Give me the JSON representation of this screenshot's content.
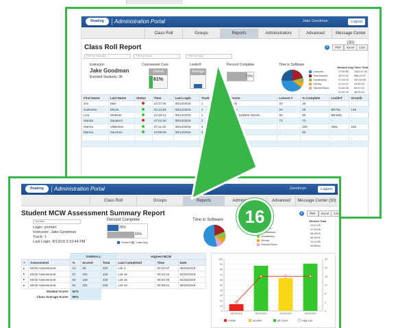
{
  "colors": {
    "accent_green": "#3ab54a",
    "header_blue": "#1e4d8c",
    "red": "#e8231c",
    "green": "#35c52d",
    "yellow": "#f7d716"
  },
  "top_stub": {
    "visible": true
  },
  "back": {
    "app": {
      "logo": "Reading Discovery",
      "title": "Administration Portal",
      "user": "Jake Goodman",
      "logout": "Logout"
    },
    "tabs": [
      "Class Roll",
      "Groups",
      "Reports",
      "Administrators",
      "Advanced",
      "Message Center (30)"
    ],
    "active_tab": "Reports",
    "report_title": "Class Roll Report",
    "buttons": [
      "PDF",
      "Excel",
      "CSV"
    ],
    "filters": [
      "Filter by Instructor",
      "Filter by Group",
      "Filter by Track"
    ],
    "instructor_label": "Instructor:",
    "instructor_name": "Jake Goodman",
    "enrolled": "Enrolled Students: 36",
    "summary_labels": [
      "Coursework Core",
      "Lexile®",
      "Percent Complete",
      "Time in Software"
    ],
    "overall_label": "Overall",
    "overall_value": "61%",
    "average_label": "Average",
    "percent_complete": "73%",
    "time_legend": [
      "Lessons",
      "Test/Assess",
      "Vocabulary",
      "Library",
      "Games/Store"
    ],
    "student_avg_label": "Student Avg",
    "class_total_label": "Class Total",
    "student_avg_values": [
      "27:50:56",
      "15:22:42",
      "07:28:16",
      "01:12:47",
      "01:46:38",
      "01:52:26"
    ],
    "class_total_values": [
      "1002:47:33",
      "566:12:47",
      "267:45:55",
      "43:40:25",
      "60:57:13",
      "68:05:18"
    ],
    "columns": [
      "First Name",
      "Last Name",
      "Status",
      "Time",
      "Last Login",
      "Track",
      "Current Lesson",
      "Lesson #",
      "% Complete",
      "Lexile®",
      "Growth"
    ],
    "rows": [
      [
        "Jon",
        "Mari",
        "red",
        "23:37:05",
        "08/13/2016",
        "1",
        "Chapter 1 Test",
        "20",
        "26",
        "-",
        "-"
      ],
      [
        "Katherine",
        "Moore",
        "green",
        "02:12:59",
        "08/14/2016",
        "1",
        "Chapter 1 Test",
        "20",
        "28",
        "BR75L",
        "135"
      ],
      [
        "Liza",
        "Webster",
        "green",
        "23:46:21",
        "08/14/2016",
        "1",
        "Decoding Multi Syllable Words",
        "80",
        "95",
        "BR490L",
        "-"
      ],
      [
        "Manda",
        "Zapatero",
        "red",
        "47:01:53",
        "08/13/2016",
        "1",
        "Chapter 3 Test",
        "73",
        "73",
        "-",
        "-"
      ],
      [
        "Marina",
        "Villalobos",
        "green",
        "37:11:40",
        "08/14/2016",
        "3",
        "Course Complete",
        "-",
        "100",
        "265L",
        "150"
      ],
      [
        "Marina",
        "Sanchez",
        "green",
        "23:56:00",
        "08/14/2016",
        "3",
        "Decoding Skill 1",
        "-",
        "82",
        "-",
        "-"
      ],
      [
        "",
        "",
        "none",
        "",
        "",
        "",
        "",
        "",
        "",
        "-",
        "-"
      ],
      [
        "",
        "",
        "none",
        "",
        "",
        "",
        "",
        "",
        "",
        "-",
        "-"
      ]
    ]
  },
  "badge": "16",
  "front": {
    "app": {
      "logo": "Reading Discovery",
      "title": "Administration Portal",
      "user": "Goodman",
      "logout": "Logout"
    },
    "tabs": [
      "Class Roll",
      "Groups",
      "Reports",
      "Administrators",
      "Advanced",
      "Message Center (30)"
    ],
    "active_tab": "Reports",
    "report_title": "Student MCW Assessment Summary Report",
    "buttons": [
      "PDF",
      "Excel",
      "CSV"
    ],
    "student_select": "Jon Mari",
    "login": "Login: jonmari",
    "instructor": "Instructor: Jake Goodman",
    "track": "Track: 1",
    "last_login": "Last Login: 8/13/19 3:19:44 PM",
    "percent_label": "Percent Complete",
    "student_pct": "26%",
    "class_pct": "65%",
    "pct_legend": [
      "Student",
      "Class Avg"
    ],
    "time_label": "Time in Software",
    "time_legend": [
      "Lessons",
      "Test/Assess",
      "Vocabulary",
      "Library",
      "Games/Store"
    ],
    "student_total_label": "Student Total",
    "student_total_values": [
      "23:37:05",
      "07:21:08",
      "08:18:09",
      "00:28:01",
      "01:41:56",
      "00:58:54"
    ],
    "table": {
      "group_overall": "OVERALL",
      "group_highest": "Highest MCW",
      "columns": [
        "Assessment",
        "%",
        "Scored",
        "Total",
        "Last Completed",
        "Time",
        "Date"
      ],
      "rows": [
        [
          "MCW Assessment",
          "13",
          "29",
          "220",
          "List 4",
          "00:02:57",
          "08/23/2018"
        ],
        [
          "MCW Assessment",
          "87",
          "191",
          "220",
          "List 16",
          "00:13:24",
          "02/20/2019"
        ],
        [
          "MCW Assessment",
          "63",
          "139",
          "220",
          "List 16",
          "00:02:35",
          "02/25/2019"
        ],
        [
          "MCW Assessment",
          "91",
          "201",
          "220",
          "List 16",
          "00:05:51",
          "05/20/2019"
        ]
      ],
      "student_score_label": "Student Score:",
      "student_score": "91%",
      "class_score_label": "Class Average Score:",
      "class_score": "89%"
    },
    "chart_legend": [
      "0-50%",
      "50-85%",
      "85-100%",
      "High List"
    ]
  },
  "chart_data": {
    "type": "bar",
    "categories": [
      "08/23/2018",
      "02/20/2019",
      "02/25/2019",
      "05/20/2019"
    ],
    "series": [
      {
        "values": [
          13,
          87,
          63,
          91
        ]
      },
      {
        "values": [
          4,
          16,
          16,
          16
        ]
      }
    ],
    "bar_colors": [
      "#e8231c",
      "#35c52d",
      "#f7d716",
      "#35c52d"
    ],
    "ylim": [
      0,
      100
    ],
    "y2lim": [
      0,
      24
    ],
    "yticks": [
      0,
      10,
      20,
      30,
      40,
      50,
      60,
      70,
      80,
      90,
      100
    ],
    "y2ticks": [
      0,
      4,
      8,
      12,
      16,
      20,
      24
    ],
    "legend": [
      "0-50%",
      "50-85%",
      "85-100%",
      "High List"
    ]
  }
}
